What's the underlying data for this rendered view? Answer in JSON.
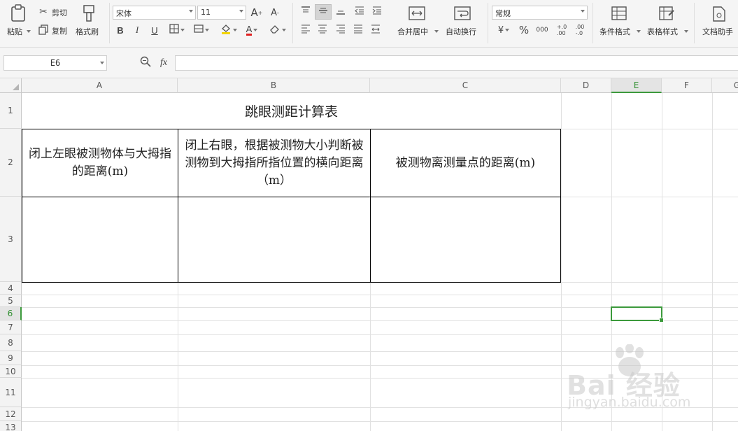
{
  "ribbon": {
    "paste": "粘贴",
    "cut": "剪切",
    "copy": "复制",
    "format_painter": "格式刷",
    "font_name": "宋体",
    "font_size": "11",
    "merge_center": "合并居中",
    "wrap_text": "自动换行",
    "number_format": "常规",
    "percent": "%",
    "conditional_format": "条件格式",
    "table_style": "表格样式",
    "doc_assistant": "文档助手",
    "bold": "B",
    "italic": "I",
    "underline": "U",
    "grow_font": "A",
    "shrink_font": "A"
  },
  "formula_bar": {
    "name_box": "E6",
    "fx_label": "fx",
    "formula": ""
  },
  "columns": [
    "A",
    "B",
    "C",
    "D",
    "E",
    "F",
    "G"
  ],
  "selected_column": "E",
  "rows": [
    "1",
    "2",
    "3",
    "4",
    "5",
    "6",
    "7",
    "8",
    "9",
    "10",
    "11",
    "12",
    "13"
  ],
  "selected_row": "6",
  "sheet": {
    "title": "跳眼测距计算表",
    "headers": [
      "闭上左眼被测物体与大拇指的距离(m)",
      "闭上右眼，根据被测物大小判断被测物到大拇指所指位置的横向距离（m）",
      "被测物离测量点的距离(m)"
    ]
  },
  "watermark": {
    "brand": "Bai 经验",
    "url": "jingyan.baidu.com"
  },
  "colors": {
    "selection": "#3c9a3c",
    "ribbon_bg": "#f5f5f5"
  }
}
